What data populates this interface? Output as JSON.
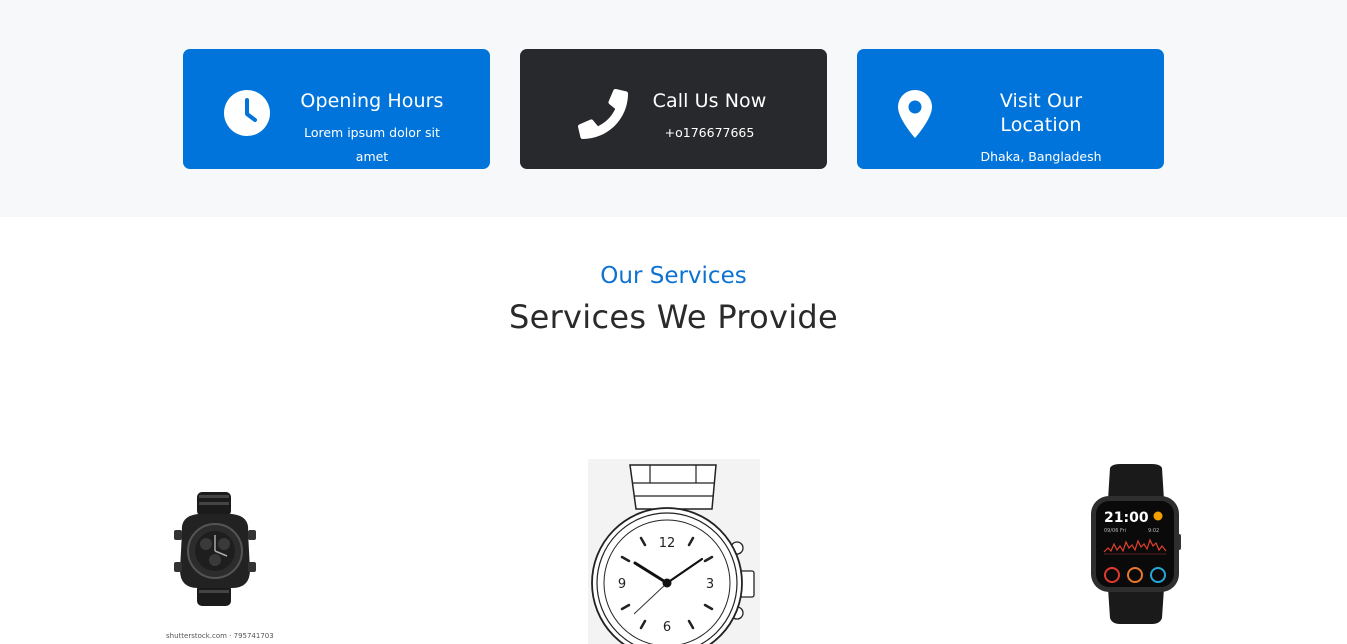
{
  "info_cards": [
    {
      "title": "Opening Hours",
      "subtitle": "Lorem ipsum dolor sit amet",
      "icon": "clock-icon"
    },
    {
      "title": "Call Us Now",
      "subtitle": "+o176677665",
      "icon": "phone-icon"
    },
    {
      "title": "Visit Our Location",
      "subtitle": "Dhaka, Bangladesh",
      "icon": "location-pin-icon"
    }
  ],
  "services": {
    "eyebrow": "Our Services",
    "heading": "Services We Provide"
  },
  "products": [
    {
      "name": "black-sport-watch",
      "caption": "shutterstock.com · 795741703"
    },
    {
      "name": "analog-watch-sketch",
      "dial": [
        "12",
        "3",
        "6",
        "9"
      ]
    },
    {
      "name": "smartwatch",
      "time": "21:00",
      "date": "09/06 Fri",
      "secondary_time": "9:02"
    }
  ],
  "colors": {
    "primary_blue": "#0174db",
    "dark_card": "#28292c",
    "band_bg": "#f7f8fa",
    "eyebrow": "#0d72d1"
  }
}
